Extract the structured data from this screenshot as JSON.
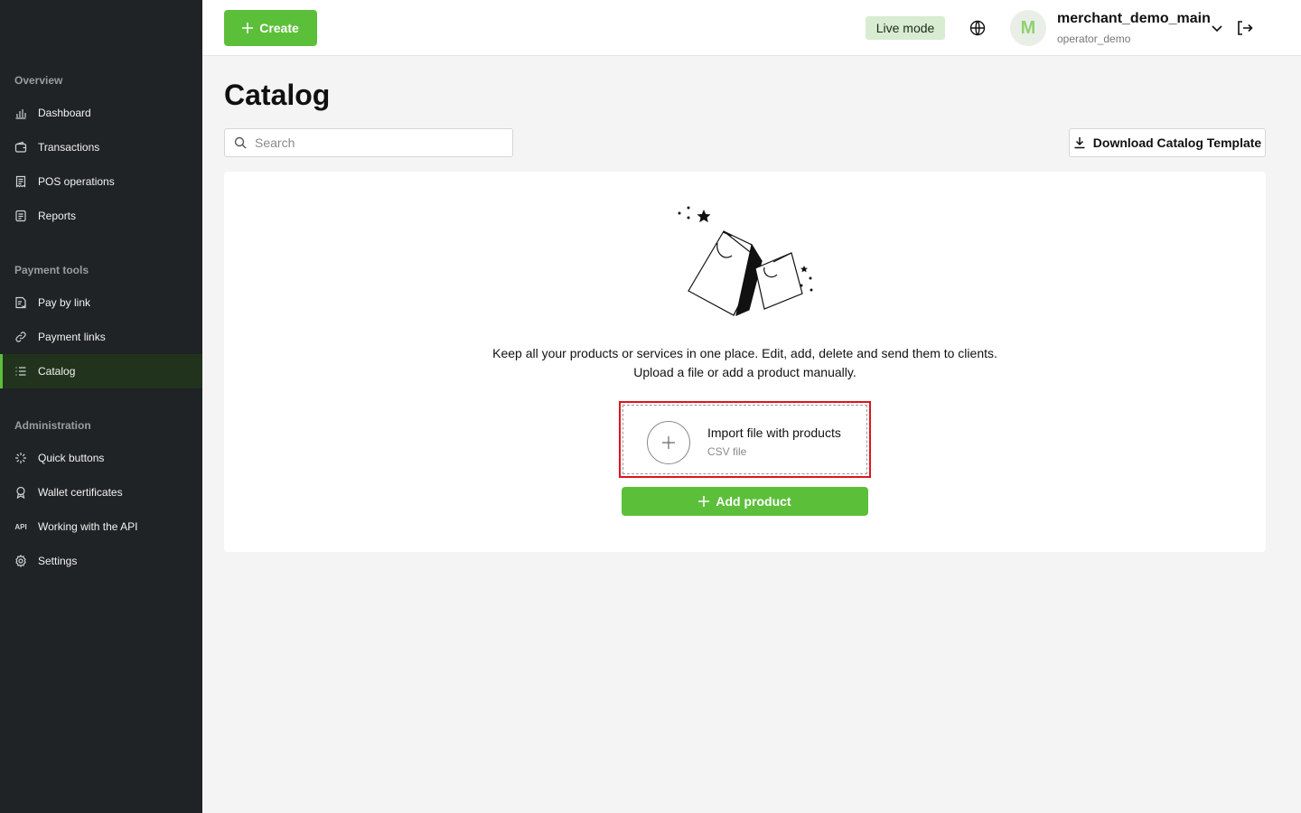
{
  "sidebar": {
    "sections": [
      {
        "title": "Overview",
        "items": [
          {
            "label": "Dashboard",
            "icon": "chart-icon"
          },
          {
            "label": "Transactions",
            "icon": "wallet-icon"
          },
          {
            "label": "POS operations",
            "icon": "receipt-icon"
          },
          {
            "label": "Reports",
            "icon": "document-icon"
          }
        ]
      },
      {
        "title": "Payment tools",
        "items": [
          {
            "label": "Pay by link",
            "icon": "invoice-icon"
          },
          {
            "label": "Payment links",
            "icon": "link-icon"
          },
          {
            "label": "Catalog",
            "icon": "list-icon",
            "active": true
          }
        ]
      },
      {
        "title": "Administration",
        "items": [
          {
            "label": "Quick buttons",
            "icon": "sparkle-icon"
          },
          {
            "label": "Wallet certificates",
            "icon": "certificate-icon"
          },
          {
            "label": "Working with the API",
            "icon": "api-icon"
          },
          {
            "label": "Settings",
            "icon": "gear-icon"
          }
        ]
      }
    ],
    "api_icon_text": "API"
  },
  "header": {
    "create_label": "Create",
    "live_mode_label": "Live mode",
    "avatar_letter": "M",
    "user_name": "merchant_demo_main",
    "user_role": "operator_demo"
  },
  "main": {
    "title": "Catalog",
    "search_placeholder": "Search",
    "download_label": "Download Catalog Template",
    "empty_state": {
      "line1": "Keep all your products or services in one place. Edit, add, delete and send them to clients.",
      "line2": "Upload a file or add a product manually."
    },
    "import": {
      "title": "Import file with products",
      "subtitle": "CSV file"
    },
    "add_product_label": "Add product"
  },
  "colors": {
    "accent": "#5cbf3a",
    "sidebar_bg": "#202325",
    "active_bg": "#21331d",
    "highlight": "#e0141e"
  }
}
